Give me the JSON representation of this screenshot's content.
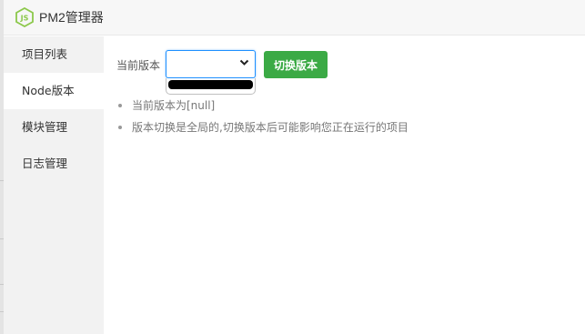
{
  "app": {
    "title": "PM2管理器",
    "logo_icon": "nodejs-icon",
    "logo_text": "JS"
  },
  "sidebar": {
    "items": [
      {
        "label": "项目列表",
        "active": false
      },
      {
        "label": "Node版本",
        "active": true
      },
      {
        "label": "模块管理",
        "active": false
      },
      {
        "label": "日志管理",
        "active": false
      }
    ]
  },
  "version": {
    "label": "当前版本",
    "selected": "",
    "switch_button": "切换版本"
  },
  "notes": [
    "当前版本为[null]",
    "版本切换是全局的,切换版本后可能影响您正在运行的项目"
  ],
  "colors": {
    "accent_green": "#3baa45",
    "focus_blue": "#1e90ff",
    "logo_green": "#8cc84b",
    "sidebar_bg": "#f2f2f2"
  }
}
